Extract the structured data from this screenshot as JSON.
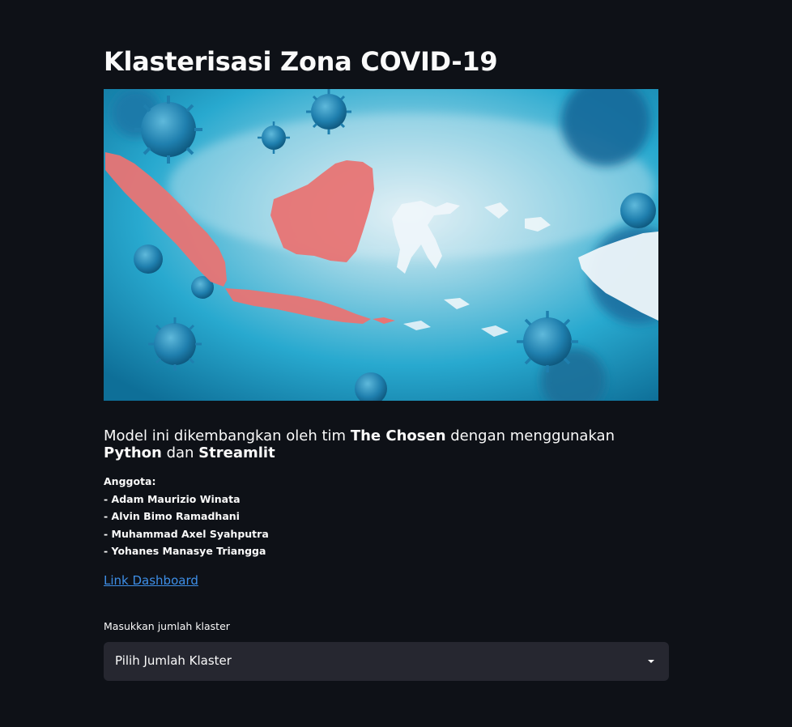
{
  "page": {
    "title": "Klasterisasi Zona COVID-19"
  },
  "hero_image": {
    "alt": "Peta Indonesia dengan virus COVID-19"
  },
  "intro": {
    "part1": "Model ini dikembangkan oleh tim ",
    "team": "The Chosen",
    "part2": " dengan menggunakan ",
    "tool1": "Python",
    "part3": " dan ",
    "tool2": "Streamlit"
  },
  "members": {
    "heading": "Anggota:",
    "list": [
      "- Adam Maurizio Winata",
      "- Alvin Bimo Ramadhani",
      "- Muhammad Axel Syahputra",
      "- Yohanes Manasye Triangga"
    ]
  },
  "dashboard_link": {
    "label": "Link Dashboard"
  },
  "cluster_select": {
    "label": "Masukkan jumlah klaster",
    "value": "Pilih Jumlah Klaster"
  },
  "colors": {
    "background": "#0e1117",
    "text": "#fafafa",
    "link": "#3e8fe8",
    "select_bg": "#262730",
    "map_red": "#e87474",
    "map_white": "#eef6fa",
    "virus": "#1e7ea8"
  }
}
